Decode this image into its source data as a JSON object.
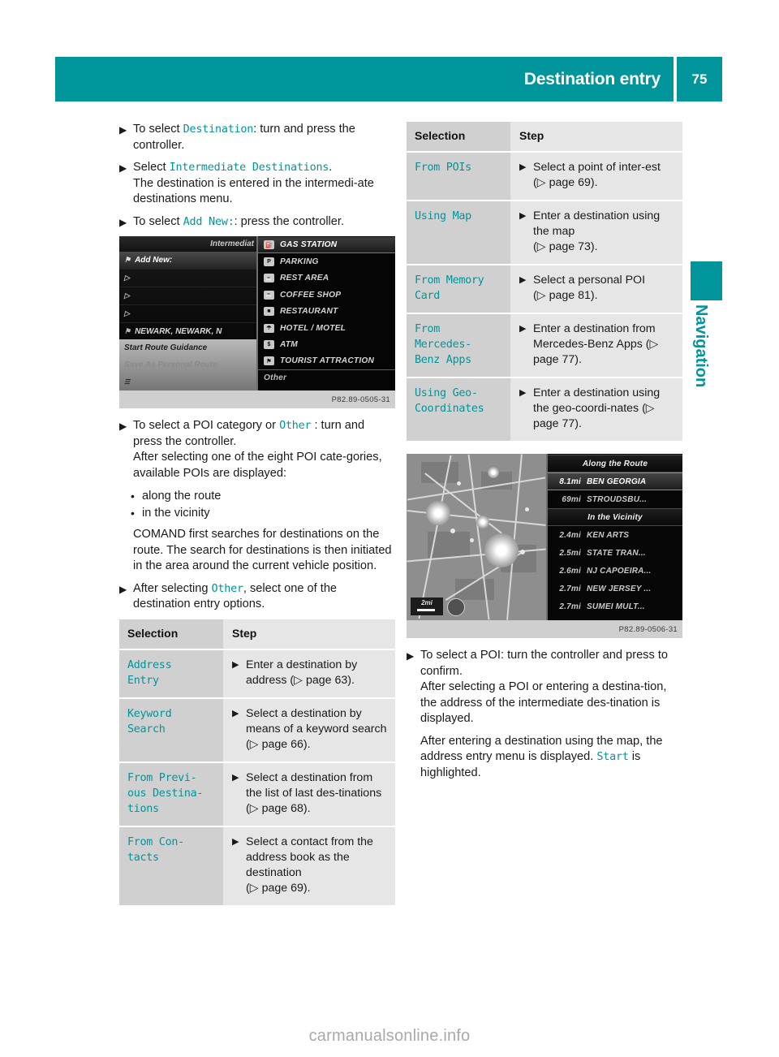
{
  "header": {
    "title": "Destination entry",
    "page_number": "75"
  },
  "side_tab": {
    "label": "Navigation",
    "color": "#00959b"
  },
  "colors": {
    "accent": "#00959b",
    "table_label_bg": "#d0d0d0",
    "table_step_bg": "#e6e6e6"
  },
  "left_column": {
    "steps": [
      {
        "marker": "▶",
        "parts": [
          {
            "t": "To select ",
            "ui": false
          },
          {
            "t": "Destination",
            "ui": true
          },
          {
            "t": ": turn and press the controller.",
            "ui": false
          }
        ]
      },
      {
        "marker": "▶",
        "parts": [
          {
            "t": "Select ",
            "ui": false
          },
          {
            "t": "Intermediate Destinations",
            "ui": true
          },
          {
            "t": ".",
            "ui": false
          }
        ],
        "follow": "The destination is entered in the intermedi-ate destinations menu."
      },
      {
        "marker": "▶",
        "parts": [
          {
            "t": "To select ",
            "ui": false
          },
          {
            "t": "Add New:",
            "ui": true
          },
          {
            "t": ": press the controller.",
            "ui": false
          }
        ]
      }
    ],
    "follow_text_1": "The destination is entered in the intermedi-",
    "follow_text_2": "ate destinations menu.",
    "figure1": {
      "caption": "P82.89-0505-31",
      "menu_title": "Intermediat",
      "menu_rows": [
        {
          "icon": "⚑",
          "label": "Add New:",
          "selected": true
        },
        {
          "icon": "▷",
          "label": "",
          "selected": false
        },
        {
          "icon": "▷",
          "label": "",
          "selected": false
        },
        {
          "icon": "▷",
          "label": "",
          "selected": false
        },
        {
          "icon": "⚑",
          "label": "NEWARK, NEWARK, N",
          "selected": false
        }
      ],
      "footer_rows": [
        {
          "label": "Start Route Guidance",
          "dim": false
        },
        {
          "label": "Save As Personal Route",
          "dim": true
        },
        {
          "label": "☰",
          "dim": false,
          "small": true
        }
      ],
      "poi_categories": [
        {
          "glyph": "⛽",
          "label": "GAS STATION",
          "selected": true
        },
        {
          "glyph": "P",
          "label": "PARKING",
          "selected": false
        },
        {
          "glyph": "☕",
          "label": "REST AREA",
          "selected": false
        },
        {
          "glyph": "☕",
          "label": "COFFEE SHOP",
          "selected": false
        },
        {
          "glyph": "■",
          "label": "RESTAURANT",
          "selected": false
        },
        {
          "glyph": "☂",
          "label": "HOTEL / MOTEL",
          "selected": false
        },
        {
          "glyph": "$",
          "label": "ATM",
          "selected": false
        },
        {
          "glyph": "⚑",
          "label": "TOURIST ATTRACTION",
          "selected": false
        }
      ],
      "other_label": "Other"
    },
    "step_poi": {
      "marker": "▶",
      "p1": "To select a POI category or ",
      "ui": "Other",
      "p2": " : turn and press the controller.",
      "follow_1": "After selecting one of the eight POI cate-",
      "follow_2": "gories, available POIs are displayed:",
      "bullets": [
        {
          "dot": "▪",
          "label": "along the route"
        },
        {
          "dot": "▪",
          "label": "in the vicinity"
        }
      ],
      "paragraph": "COMAND first searches for destinations on the route. The search for destinations is then initiated in the area around the current vehicle position."
    },
    "step_other": {
      "marker": "▶",
      "p1": "After selecting ",
      "ui": "Other",
      "p2": ", select one of the destination entry options."
    },
    "table": {
      "headers": {
        "selection": "Selection",
        "step": "Step"
      },
      "rows": [
        {
          "selection": "Address\nEntry",
          "marker": "▶",
          "step": "Enter a destination by address (▷ page 63)."
        },
        {
          "selection": "Keyword\nSearch",
          "marker": "▶",
          "step": "Select a destination by means of a keyword search (▷ page 66)."
        },
        {
          "selection": "From Previ-\nous Destina-\ntions",
          "marker": "▶",
          "step": "Select a destination from the list of last des-tinations (▷ page 68)."
        },
        {
          "selection": "From Con-\ntacts",
          "marker": "▶",
          "step": "Select a contact from the address book as the destination\n(▷ page 69)."
        }
      ]
    }
  },
  "right_column": {
    "table": {
      "headers": {
        "selection": "Selection",
        "step": "Step"
      },
      "rows": [
        {
          "selection": "From POIs",
          "marker": "▶",
          "step": "Select a point of inter-est (▷ page 69)."
        },
        {
          "selection": "Using Map",
          "marker": "▶",
          "step": "Enter a destination using the map\n(▷ page 73)."
        },
        {
          "selection": "From Memory\nCard",
          "marker": "▶",
          "step": "Select a personal POI\n(▷ page 81)."
        },
        {
          "selection": "From\nMercedes-\nBenz Apps",
          "marker": "▶",
          "step": "Enter a destination from Mercedes-Benz Apps (▷ page 77)."
        },
        {
          "selection": "Using Geo-\nCoordinates",
          "marker": "▶",
          "step": "Enter a destination using the geo-coordi-nates (▷ page 77)."
        }
      ]
    },
    "figure2": {
      "caption": "P82.89-0506-31",
      "map_scale": "2mi",
      "list": [
        {
          "type": "header",
          "label": "Along the Route"
        },
        {
          "type": "item",
          "dist": "8.1mi",
          "label": "BEN GEORGIA",
          "selected": true
        },
        {
          "type": "item",
          "dist": "69mi",
          "label": "STROUDSBU...",
          "selected": false
        },
        {
          "type": "header",
          "label": "In the Vicinity"
        },
        {
          "type": "item",
          "dist": "2.4mi",
          "label": "KEN ARTS",
          "selected": false
        },
        {
          "type": "item",
          "dist": "2.5mi",
          "label": "STATE TRAN...",
          "selected": false
        },
        {
          "type": "item",
          "dist": "2.6mi",
          "label": "NJ CAPOEIRA...",
          "selected": false
        },
        {
          "type": "item",
          "dist": "2.7mi",
          "label": "NEW JERSEY ...",
          "selected": false
        },
        {
          "type": "item",
          "dist": "2.7mi",
          "label": "SUMEI MULT...",
          "selected": false
        }
      ]
    },
    "step_poi": {
      "marker": "▶",
      "text": "To select a POI: turn the controller and press to confirm.",
      "follow": "After selecting a POI or entering a destina-tion, the address of the intermediate des-tination is displayed."
    },
    "paragraph_parts": {
      "p1": "After entering a destination using the map, the address entry menu is displayed. ",
      "ui": "Start",
      "p2": " is highlighted."
    }
  },
  "watermark": "carmanualsonline.info"
}
